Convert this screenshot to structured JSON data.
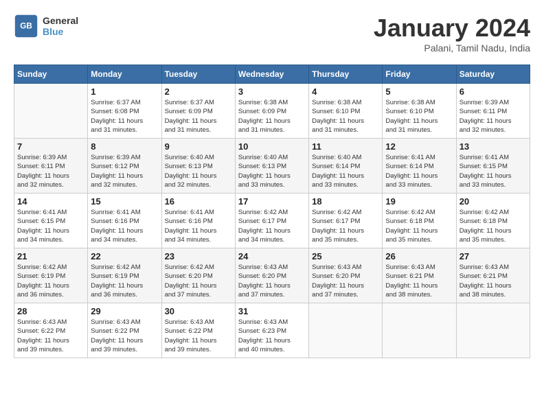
{
  "logo": {
    "line1": "General",
    "line2": "Blue"
  },
  "title": "January 2024",
  "subtitle": "Palani, Tamil Nadu, India",
  "days_of_week": [
    "Sunday",
    "Monday",
    "Tuesday",
    "Wednesday",
    "Thursday",
    "Friday",
    "Saturday"
  ],
  "weeks": [
    [
      {
        "day": "",
        "info": ""
      },
      {
        "day": "1",
        "info": "Sunrise: 6:37 AM\nSunset: 6:08 PM\nDaylight: 11 hours\nand 31 minutes."
      },
      {
        "day": "2",
        "info": "Sunrise: 6:37 AM\nSunset: 6:09 PM\nDaylight: 11 hours\nand 31 minutes."
      },
      {
        "day": "3",
        "info": "Sunrise: 6:38 AM\nSunset: 6:09 PM\nDaylight: 11 hours\nand 31 minutes."
      },
      {
        "day": "4",
        "info": "Sunrise: 6:38 AM\nSunset: 6:10 PM\nDaylight: 11 hours\nand 31 minutes."
      },
      {
        "day": "5",
        "info": "Sunrise: 6:38 AM\nSunset: 6:10 PM\nDaylight: 11 hours\nand 31 minutes."
      },
      {
        "day": "6",
        "info": "Sunrise: 6:39 AM\nSunset: 6:11 PM\nDaylight: 11 hours\nand 32 minutes."
      }
    ],
    [
      {
        "day": "7",
        "info": "Sunrise: 6:39 AM\nSunset: 6:11 PM\nDaylight: 11 hours\nand 32 minutes."
      },
      {
        "day": "8",
        "info": "Sunrise: 6:39 AM\nSunset: 6:12 PM\nDaylight: 11 hours\nand 32 minutes."
      },
      {
        "day": "9",
        "info": "Sunrise: 6:40 AM\nSunset: 6:13 PM\nDaylight: 11 hours\nand 32 minutes."
      },
      {
        "day": "10",
        "info": "Sunrise: 6:40 AM\nSunset: 6:13 PM\nDaylight: 11 hours\nand 33 minutes."
      },
      {
        "day": "11",
        "info": "Sunrise: 6:40 AM\nSunset: 6:14 PM\nDaylight: 11 hours\nand 33 minutes."
      },
      {
        "day": "12",
        "info": "Sunrise: 6:41 AM\nSunset: 6:14 PM\nDaylight: 11 hours\nand 33 minutes."
      },
      {
        "day": "13",
        "info": "Sunrise: 6:41 AM\nSunset: 6:15 PM\nDaylight: 11 hours\nand 33 minutes."
      }
    ],
    [
      {
        "day": "14",
        "info": "Sunrise: 6:41 AM\nSunset: 6:15 PM\nDaylight: 11 hours\nand 34 minutes."
      },
      {
        "day": "15",
        "info": "Sunrise: 6:41 AM\nSunset: 6:16 PM\nDaylight: 11 hours\nand 34 minutes."
      },
      {
        "day": "16",
        "info": "Sunrise: 6:41 AM\nSunset: 6:16 PM\nDaylight: 11 hours\nand 34 minutes."
      },
      {
        "day": "17",
        "info": "Sunrise: 6:42 AM\nSunset: 6:17 PM\nDaylight: 11 hours\nand 34 minutes."
      },
      {
        "day": "18",
        "info": "Sunrise: 6:42 AM\nSunset: 6:17 PM\nDaylight: 11 hours\nand 35 minutes."
      },
      {
        "day": "19",
        "info": "Sunrise: 6:42 AM\nSunset: 6:18 PM\nDaylight: 11 hours\nand 35 minutes."
      },
      {
        "day": "20",
        "info": "Sunrise: 6:42 AM\nSunset: 6:18 PM\nDaylight: 11 hours\nand 35 minutes."
      }
    ],
    [
      {
        "day": "21",
        "info": "Sunrise: 6:42 AM\nSunset: 6:19 PM\nDaylight: 11 hours\nand 36 minutes."
      },
      {
        "day": "22",
        "info": "Sunrise: 6:42 AM\nSunset: 6:19 PM\nDaylight: 11 hours\nand 36 minutes."
      },
      {
        "day": "23",
        "info": "Sunrise: 6:42 AM\nSunset: 6:20 PM\nDaylight: 11 hours\nand 37 minutes."
      },
      {
        "day": "24",
        "info": "Sunrise: 6:43 AM\nSunset: 6:20 PM\nDaylight: 11 hours\nand 37 minutes."
      },
      {
        "day": "25",
        "info": "Sunrise: 6:43 AM\nSunset: 6:20 PM\nDaylight: 11 hours\nand 37 minutes."
      },
      {
        "day": "26",
        "info": "Sunrise: 6:43 AM\nSunset: 6:21 PM\nDaylight: 11 hours\nand 38 minutes."
      },
      {
        "day": "27",
        "info": "Sunrise: 6:43 AM\nSunset: 6:21 PM\nDaylight: 11 hours\nand 38 minutes."
      }
    ],
    [
      {
        "day": "28",
        "info": "Sunrise: 6:43 AM\nSunset: 6:22 PM\nDaylight: 11 hours\nand 39 minutes."
      },
      {
        "day": "29",
        "info": "Sunrise: 6:43 AM\nSunset: 6:22 PM\nDaylight: 11 hours\nand 39 minutes."
      },
      {
        "day": "30",
        "info": "Sunrise: 6:43 AM\nSunset: 6:22 PM\nDaylight: 11 hours\nand 39 minutes."
      },
      {
        "day": "31",
        "info": "Sunrise: 6:43 AM\nSunset: 6:23 PM\nDaylight: 11 hours\nand 40 minutes."
      },
      {
        "day": "",
        "info": ""
      },
      {
        "day": "",
        "info": ""
      },
      {
        "day": "",
        "info": ""
      }
    ]
  ]
}
